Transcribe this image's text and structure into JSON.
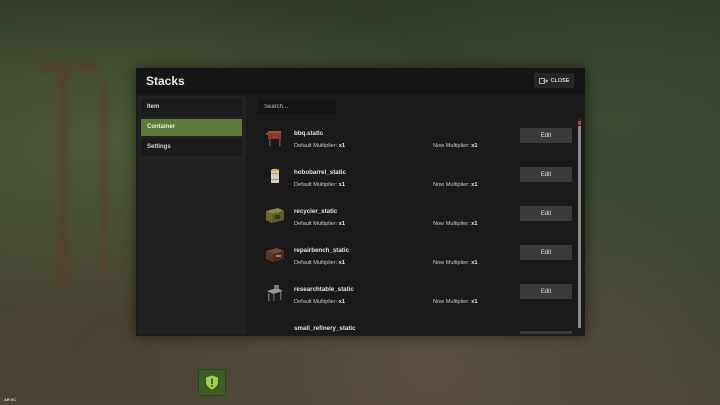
{
  "window": {
    "title": "Stacks",
    "close_label": "CLOSE"
  },
  "sidebar": {
    "items": [
      {
        "label": "Item",
        "active": false
      },
      {
        "label": "Container",
        "active": true
      },
      {
        "label": "Settings",
        "active": false
      }
    ]
  },
  "search": {
    "placeholder": "Search..."
  },
  "rows": [
    {
      "name": "bbq.static",
      "default_label": "Default Multiplier:",
      "default_value": "x1",
      "now_label": "Now Multiplier:",
      "now_value": "x1",
      "edit_label": "Edit",
      "icon": "bbq-icon"
    },
    {
      "name": "hobobarrel_static",
      "default_label": "Default Multiplier:",
      "default_value": "x1",
      "now_label": "Now Multiplier:",
      "now_value": "x1",
      "edit_label": "Edit",
      "icon": "hobo-barrel-icon"
    },
    {
      "name": "recycler_static",
      "default_label": "Default Multiplier:",
      "default_value": "x1",
      "now_label": "Now Multiplier:",
      "now_value": "x1",
      "edit_label": "Edit",
      "icon": "recycler-icon"
    },
    {
      "name": "repairbench_static",
      "default_label": "Default Multiplier:",
      "default_value": "x1",
      "now_label": "Now Multiplier:",
      "now_value": "x1",
      "edit_label": "Edit",
      "icon": "repair-bench-icon"
    },
    {
      "name": "researchtable_static",
      "default_label": "Default Multiplier:",
      "default_value": "x1",
      "now_label": "Now Multiplier:",
      "now_value": "x1",
      "edit_label": "Edit",
      "icon": "research-table-icon"
    },
    {
      "name": "small_refinery_static",
      "default_label": "",
      "default_value": "",
      "now_label": "",
      "now_value": "",
      "edit_label": "",
      "icon": "small-refinery-icon"
    }
  ],
  "hud": {
    "corner_text": "AR 6C",
    "shield_icon": "shield-alert-icon"
  },
  "colors": {
    "accent": "#5e7a3b",
    "panel": "#1c1c1c",
    "button": "#3b3b3b",
    "scroll_marker": "#c03a3a"
  }
}
